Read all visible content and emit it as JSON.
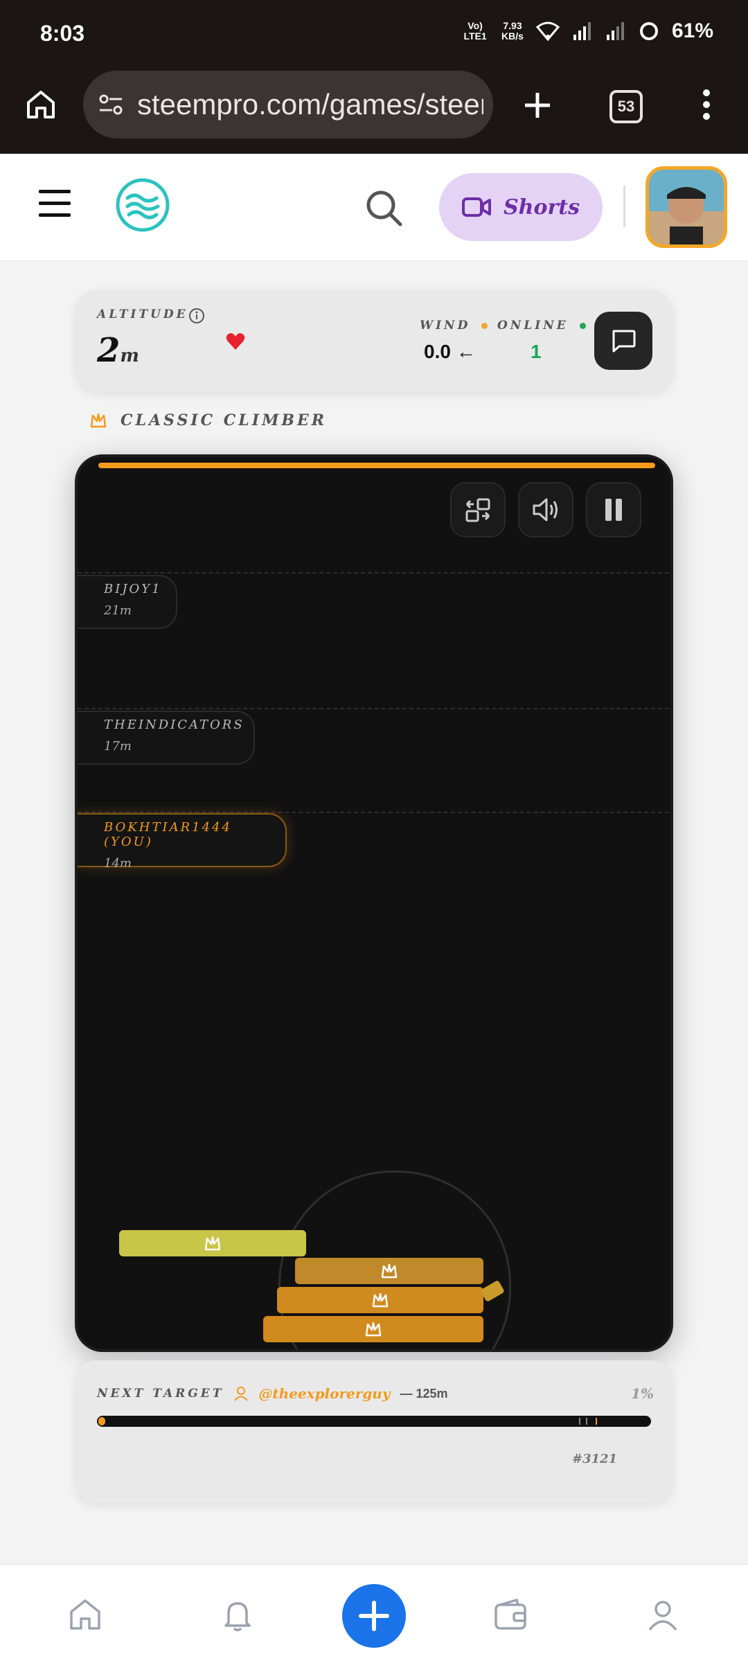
{
  "status_bar": {
    "time": "8:03",
    "volte": "Vo) LTE1",
    "speed_value": "7.93",
    "speed_unit": "KB/s",
    "battery": "61%"
  },
  "browser": {
    "url": "steempro.com/games/steer",
    "tab_count": "53"
  },
  "header": {
    "shorts_label": "Shorts",
    "accent_color": "#f3a728"
  },
  "stats": {
    "altitude_label": "ALTITUDE",
    "altitude_value": "2",
    "altitude_unit": "m",
    "wind_label": "WIND",
    "wind_value": "0.0 ←",
    "online_label": "ONLINE",
    "online_value": "1"
  },
  "mode": {
    "label": "CLASSIC CLIMBER"
  },
  "game": {
    "markers": [
      {
        "name": "BIJOY1",
        "altitude": "21m"
      },
      {
        "name": "THEINDICATORS",
        "altitude": "17m"
      },
      {
        "name": "BOKHTIAR1444 (YOU)",
        "altitude": "14m"
      }
    ],
    "top_bar_color": "#f49a1c"
  },
  "target": {
    "label": "NEXT TARGET",
    "user": "@theexplorerguy",
    "distance": "— 125m",
    "percent": "1%",
    "progress": 0.01,
    "rank": "#3121"
  },
  "icons": {
    "home": "home-icon",
    "site_info": "tune-icon",
    "add_tab": "plus-icon",
    "menu": "more-vert-icon",
    "hamburger": "menu-icon",
    "logo": "steem-logo",
    "search": "search-icon",
    "video": "video-icon",
    "info": "info-icon",
    "heart": "heart-icon",
    "chat": "chat-icon",
    "swap": "swap-icon",
    "volume": "volume-icon",
    "pause": "pause-icon",
    "bell": "bell-icon",
    "wallet": "wallet-icon",
    "user": "user-icon"
  }
}
